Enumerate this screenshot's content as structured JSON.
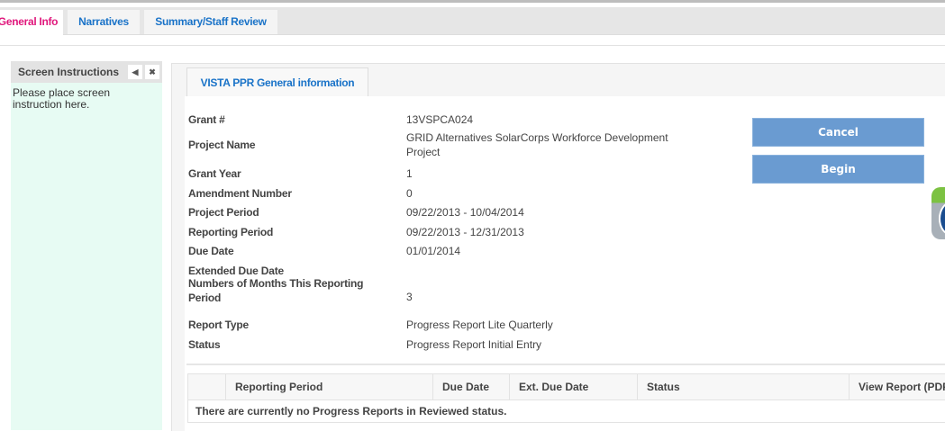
{
  "tabs": [
    {
      "label": "General Info",
      "active": true
    },
    {
      "label": "Narratives"
    },
    {
      "label": "Summary/Staff Review"
    }
  ],
  "sidebar": {
    "title": "Screen Instructions",
    "collapse_icon": "triangle-left-icon",
    "close_icon": "close-icon",
    "text": "Please place screen instruction here."
  },
  "panel": {
    "tab": "VISTA PPR General information",
    "fields": [
      {
        "label": "Grant #",
        "value": "13VSPCA024"
      },
      {
        "label": "Project Name",
        "value": "GRID Alternatives SolarCorps Workforce Development Project"
      },
      {
        "label": "Grant Year",
        "value": "1"
      },
      {
        "label": "Amendment Number",
        "value": "0"
      },
      {
        "label": "Project Period",
        "value": "09/22/2013 - 10/04/2014"
      },
      {
        "label": "Reporting Period",
        "value": "09/22/2013 - 12/31/2013"
      },
      {
        "label": "Due Date",
        "value": "01/01/2014"
      },
      {
        "label": "Extended Due Date",
        "value": ""
      },
      {
        "label": "Numbers of Months This Reporting Period",
        "value": "3"
      },
      {
        "label": "Report Type",
        "value": "Progress Report Lite Quarterly"
      },
      {
        "label": "Status",
        "value": "Progress Report Initial Entry"
      }
    ],
    "buttons": {
      "cancel": "Cancel",
      "begin": "Begin"
    },
    "table": {
      "columns": [
        "",
        "Reporting Period",
        "Due Date",
        "Ext. Due Date",
        "Status",
        "View Report (PDF)"
      ],
      "empty_message": "There are currently no Progress Reports in Reviewed status."
    }
  },
  "colors": {
    "active_tab": "#e0177c",
    "link": "#1a73c8",
    "button": "#6a9bd1",
    "sidebar_bg": "#e7fbf3"
  }
}
